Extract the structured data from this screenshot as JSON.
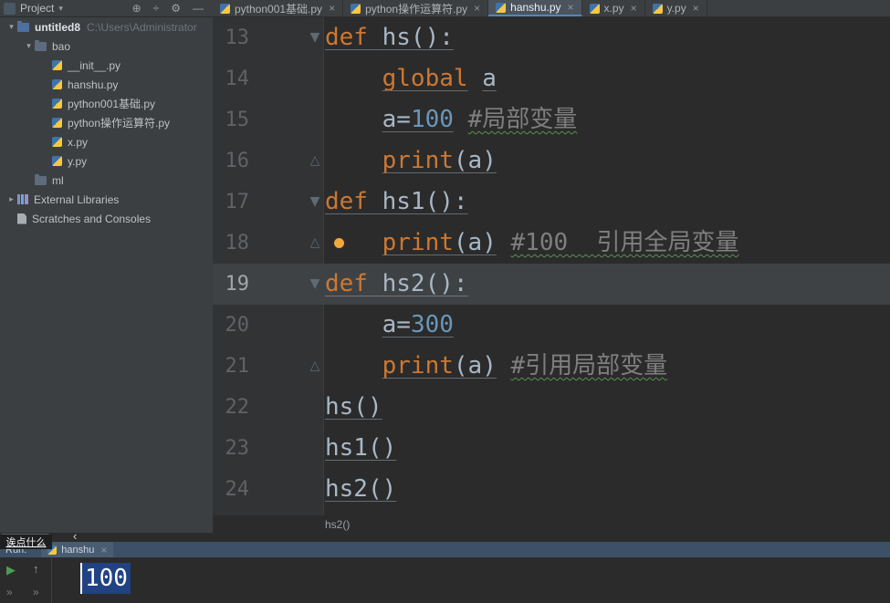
{
  "toolbar": {
    "project_label": "Project",
    "chevron": "▾",
    "icons": [
      {
        "name": "locate-icon",
        "glyph": "⊕"
      },
      {
        "name": "collapse-all-icon",
        "glyph": "÷"
      },
      {
        "name": "settings-icon",
        "glyph": "⚙"
      },
      {
        "name": "hide-panel-icon",
        "glyph": "—"
      }
    ]
  },
  "editor_tabs": [
    {
      "label": "python001基础.py",
      "active": false
    },
    {
      "label": "python操作运算符.py",
      "active": false
    },
    {
      "label": "hanshu.py",
      "active": true
    },
    {
      "label": "x.py",
      "active": false
    },
    {
      "label": "y.py",
      "active": false
    }
  ],
  "project_tree": [
    {
      "depth": 0,
      "arrow": "down",
      "icon": "project",
      "label": "untitled8",
      "extra": "C:\\Users\\Administrator",
      "bold": true
    },
    {
      "depth": 1,
      "arrow": "down",
      "icon": "folder",
      "label": "bao"
    },
    {
      "depth": 2,
      "arrow": "",
      "icon": "py",
      "label": "__init__.py"
    },
    {
      "depth": 2,
      "arrow": "",
      "icon": "py",
      "label": "hanshu.py"
    },
    {
      "depth": 2,
      "arrow": "",
      "icon": "py",
      "label": "python001基础.py"
    },
    {
      "depth": 2,
      "arrow": "",
      "icon": "py",
      "label": "python操作运算符.py"
    },
    {
      "depth": 2,
      "arrow": "",
      "icon": "py",
      "label": "x.py"
    },
    {
      "depth": 2,
      "arrow": "",
      "icon": "py",
      "label": "y.py"
    },
    {
      "depth": 1,
      "arrow": "",
      "icon": "folder",
      "label": "ml"
    },
    {
      "depth": 0,
      "arrow": "right",
      "icon": "library",
      "label": "External Libraries"
    },
    {
      "depth": 0,
      "arrow": "",
      "icon": "scratch",
      "label": "Scratches and Consoles"
    }
  ],
  "editor": {
    "lines": [
      {
        "num": 13,
        "fold": "down",
        "tokens": [
          {
            "y": "kw",
            "t": "def "
          },
          {
            "y": "fn",
            "t": "hs():"
          }
        ]
      },
      {
        "num": 14,
        "fold": "",
        "tokens": [
          {
            "y": "ws",
            "t": "    "
          },
          {
            "y": "kw",
            "t": "global"
          },
          {
            "y": "ws",
            "t": " "
          },
          {
            "y": "pl",
            "t": "a"
          }
        ]
      },
      {
        "num": 15,
        "fold": "",
        "tokens": [
          {
            "y": "ws",
            "t": "    "
          },
          {
            "y": "pl",
            "t": "a="
          },
          {
            "y": "num",
            "t": "100"
          },
          {
            "y": "ws",
            "t": " "
          },
          {
            "y": "cm",
            "t": "#局部变量"
          }
        ]
      },
      {
        "num": 16,
        "fold": "up",
        "tokens": [
          {
            "y": "ws",
            "t": "    "
          },
          {
            "y": "kw",
            "t": "print"
          },
          {
            "y": "pl",
            "t": "(a)"
          }
        ]
      },
      {
        "num": 17,
        "fold": "down",
        "tokens": [
          {
            "y": "kw",
            "t": "def "
          },
          {
            "y": "fn",
            "t": "hs1():"
          }
        ]
      },
      {
        "num": 18,
        "fold": "up",
        "bulb": true,
        "tokens": [
          {
            "y": "ws",
            "t": "    "
          },
          {
            "y": "kw",
            "t": "print"
          },
          {
            "y": "pl",
            "t": "(a)"
          },
          {
            "y": "ws",
            "t": " "
          },
          {
            "y": "cm",
            "t": "#100  引用全局变量"
          }
        ]
      },
      {
        "num": 19,
        "fold": "down",
        "current": true,
        "tokens": [
          {
            "y": "kw",
            "t": "def "
          },
          {
            "y": "fn",
            "t": "hs2():"
          }
        ]
      },
      {
        "num": 20,
        "fold": "",
        "tokens": [
          {
            "y": "ws",
            "t": "    "
          },
          {
            "y": "pl",
            "t": "a="
          },
          {
            "y": "num",
            "t": "300"
          }
        ]
      },
      {
        "num": 21,
        "fold": "up",
        "tokens": [
          {
            "y": "ws",
            "t": "    "
          },
          {
            "y": "kw",
            "t": "print"
          },
          {
            "y": "pl",
            "t": "(a)"
          },
          {
            "y": "ws",
            "t": " "
          },
          {
            "y": "cm",
            "t": "#引用局部变量"
          }
        ]
      },
      {
        "num": 22,
        "fold": "",
        "tokens": [
          {
            "y": "pl",
            "t": "hs()"
          }
        ]
      },
      {
        "num": 23,
        "fold": "",
        "tokens": [
          {
            "y": "pl",
            "t": "hs1()"
          }
        ]
      },
      {
        "num": 24,
        "fold": "",
        "tokens": [
          {
            "y": "pl",
            "t": "hs2()"
          }
        ]
      }
    ]
  },
  "breadcrumb": {
    "label": "hs2()"
  },
  "run_panel": {
    "run_label": "Run:",
    "tab_label": "hanshu",
    "console_output": "100",
    "icons": {
      "play": "▶",
      "up": "↑",
      "expand_left": "»",
      "expand_right": "»",
      "chevron": "‹"
    }
  },
  "ime_popup": {
    "text": "诶点什么"
  },
  "ui": {
    "close_glyph": "×",
    "fold_down_glyph": "▼",
    "fold_up_glyph": "△",
    "tree_collapse_glyph": "▾",
    "tree_expand_glyph": "▸"
  },
  "colors": {
    "accent_blue": "#4a88c7",
    "keyword": "#cc7832",
    "number": "#6897bb",
    "comment": "#7f7f7f",
    "plain_text": "#a9b7c6",
    "selection": "#214283",
    "editor_bg": "#2b2b2b",
    "panel_bg": "#3c3f41",
    "run_header_bg": "#3c5168",
    "bulb": "#f2a93c"
  }
}
